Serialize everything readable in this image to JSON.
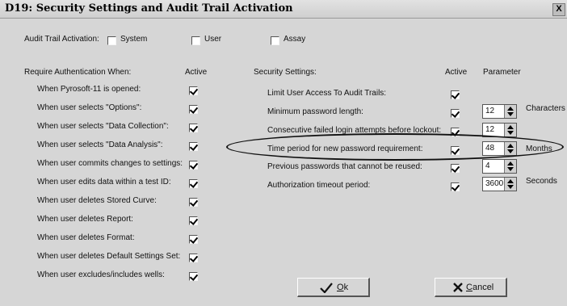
{
  "window": {
    "title": "D19: Security Settings and Audit Trail Activation",
    "close_label": "X"
  },
  "audit": {
    "label": "Audit Trail Activation:",
    "options": [
      {
        "label": "System",
        "checked": false
      },
      {
        "label": "User",
        "checked": false
      },
      {
        "label": "Assay",
        "checked": false
      }
    ]
  },
  "auth": {
    "header": "Require Authentication When:",
    "active_header": "Active",
    "items": [
      {
        "label": "When Pyrosoft-11 is opened:",
        "checked": true
      },
      {
        "label": "When user selects \"Options\":",
        "checked": true
      },
      {
        "label": "When user selects \"Data Collection\":",
        "checked": true
      },
      {
        "label": "When user selects \"Data Analysis\":",
        "checked": true
      },
      {
        "label": "When user commits changes to settings:",
        "checked": true
      },
      {
        "label": "When user edits data within a test ID:",
        "checked": true
      },
      {
        "label": "When user deletes Stored Curve:",
        "checked": true
      },
      {
        "label": "When user deletes Report:",
        "checked": true
      },
      {
        "label": "When user deletes Format:",
        "checked": true
      },
      {
        "label": "When user deletes Default Settings Set:",
        "checked": true
      },
      {
        "label": "When user excludes/includes wells:",
        "checked": true
      }
    ]
  },
  "security": {
    "header": "Security Settings:",
    "active_header": "Active",
    "parameter_header": "Parameter",
    "items": [
      {
        "label": "Limit User Access To Audit Trails:",
        "checked": true,
        "value": null,
        "unit": ""
      },
      {
        "label": "Minimum password length:",
        "checked": true,
        "value": "12",
        "unit": "Characters"
      },
      {
        "label": "Consecutive failed login attempts before lockout:",
        "checked": true,
        "value": "12",
        "unit": ""
      },
      {
        "label": "Time period for new password requirement:",
        "checked": true,
        "value": "48",
        "unit": "Months"
      },
      {
        "label": "Previous passwords that cannot be reused:",
        "checked": true,
        "value": "4",
        "unit": ""
      },
      {
        "label": "Authorization timeout period:",
        "checked": true,
        "value": "3600",
        "unit": "Seconds"
      }
    ]
  },
  "buttons": {
    "ok_label": "Ok",
    "cancel_label": "Cancel"
  },
  "icons": {
    "ok": "checkmark-icon",
    "cancel": "x-icon"
  }
}
